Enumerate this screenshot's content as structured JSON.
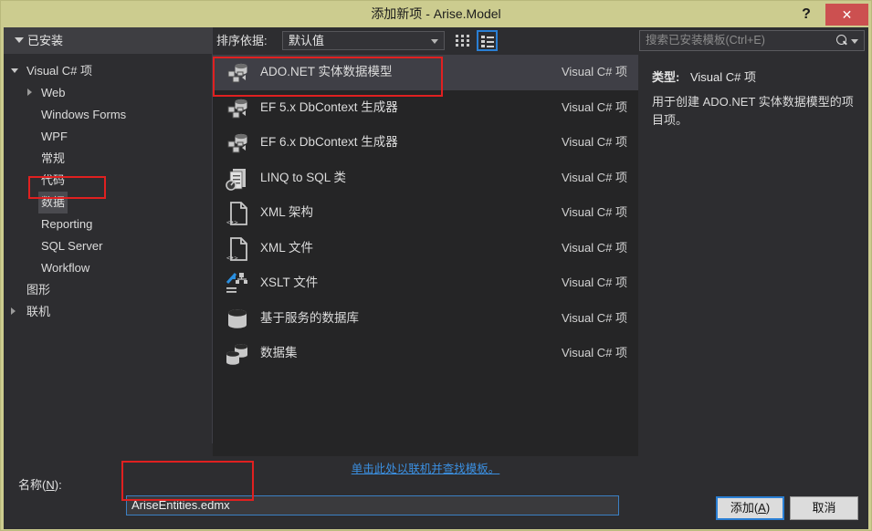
{
  "window": {
    "title": "添加新项 - Arise.Model",
    "help_label": "?",
    "close_label": "✕",
    "titlebar_color": "#cccc8f",
    "close_color": "#cc5050",
    "accent_color": "#2a7fd4",
    "annotation_color": "#e02020"
  },
  "sidebar": {
    "header_label": "已安装",
    "items": [
      {
        "label": "Visual C# 项",
        "level": 0,
        "arrow": "down",
        "selected": false
      },
      {
        "label": "Web",
        "level": 1,
        "arrow": "right",
        "selected": false
      },
      {
        "label": "Windows Forms",
        "level": 1,
        "arrow": "none",
        "selected": false
      },
      {
        "label": "WPF",
        "level": 1,
        "arrow": "none",
        "selected": false
      },
      {
        "label": "常规",
        "level": 1,
        "arrow": "none",
        "selected": false
      },
      {
        "label": "代码",
        "level": 1,
        "arrow": "none",
        "selected": false
      },
      {
        "label": "数据",
        "level": 1,
        "arrow": "none",
        "selected": true
      },
      {
        "label": "Reporting",
        "level": 1,
        "arrow": "none",
        "selected": false
      },
      {
        "label": "SQL Server",
        "level": 1,
        "arrow": "none",
        "selected": false
      },
      {
        "label": "Workflow",
        "level": 1,
        "arrow": "none",
        "selected": false
      },
      {
        "label": "图形",
        "level": 0,
        "arrow": "none",
        "selected": false
      },
      {
        "label": "联机",
        "level": 0,
        "arrow": "right",
        "selected": false
      }
    ]
  },
  "toolbar": {
    "sort_label": "排序依据:",
    "sort_value": "默认值",
    "grid_view_title": "中等图标",
    "list_view_title": "列表",
    "active_view": "list"
  },
  "search": {
    "placeholder": "搜索已安装模板(Ctrl+E)",
    "value": ""
  },
  "templates": {
    "kind_column": "Visual C# 项",
    "items": [
      {
        "name": "ADO.NET 实体数据模型",
        "kind": "Visual C# 项",
        "icon": "entity-data-model-icon",
        "selected": true
      },
      {
        "name": "EF 5.x DbContext 生成器",
        "kind": "Visual C# 项",
        "icon": "entity-data-model-icon",
        "selected": false
      },
      {
        "name": "EF 6.x DbContext 生成器",
        "kind": "Visual C# 项",
        "icon": "entity-data-model-icon",
        "selected": false
      },
      {
        "name": "LINQ to SQL 类",
        "kind": "Visual C# 项",
        "icon": "linq-to-sql-icon",
        "selected": false
      },
      {
        "name": "XML 架构",
        "kind": "Visual C# 项",
        "icon": "xml-file-icon",
        "selected": false
      },
      {
        "name": "XML 文件",
        "kind": "Visual C# 项",
        "icon": "xml-file-icon",
        "selected": false
      },
      {
        "name": "XSLT 文件",
        "kind": "Visual C# 项",
        "icon": "xslt-file-icon",
        "selected": false
      },
      {
        "name": "基于服务的数据库",
        "kind": "Visual C# 项",
        "icon": "database-icon",
        "selected": false
      },
      {
        "name": "数据集",
        "kind": "Visual C# 项",
        "icon": "dataset-icon",
        "selected": false
      }
    ]
  },
  "detail": {
    "type_label": "类型:",
    "type_value": "Visual C# 项",
    "description": "用于创建 ADO.NET 实体数据模型的项目项。"
  },
  "online_link": "单击此处以联机并查找模板。",
  "name_field": {
    "label_prefix": "名称(",
    "label_accel": "N",
    "label_suffix": "):",
    "value": "AriseEntities.edmx"
  },
  "footer": {
    "add_prefix": "添加(",
    "add_accel": "A",
    "add_suffix": ")",
    "cancel_label": "取消"
  }
}
